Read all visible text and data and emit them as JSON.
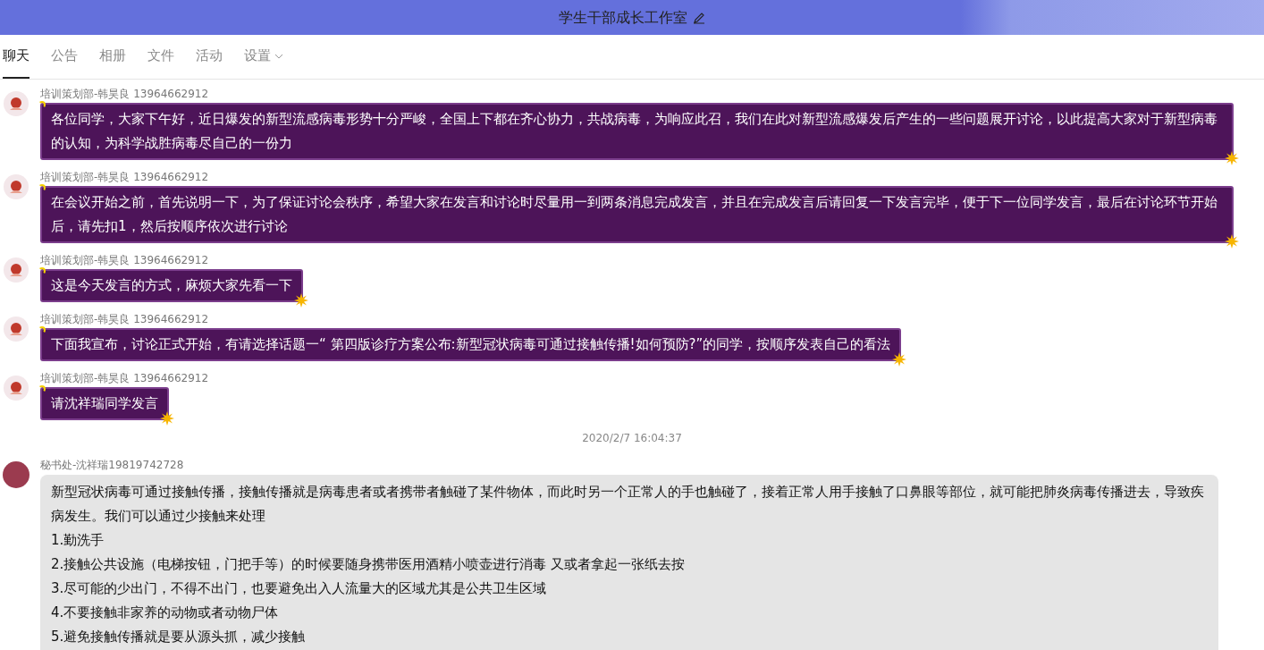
{
  "header": {
    "title": "学生干部成长工作室"
  },
  "tabs": [
    {
      "label": "聊天",
      "selected": true,
      "dropdown": false
    },
    {
      "label": "公告",
      "selected": false,
      "dropdown": false
    },
    {
      "label": "相册",
      "selected": false,
      "dropdown": false
    },
    {
      "label": "文件",
      "selected": false,
      "dropdown": false
    },
    {
      "label": "活动",
      "selected": false,
      "dropdown": false
    },
    {
      "label": "设置",
      "selected": false,
      "dropdown": true
    }
  ],
  "messages": [
    {
      "kind": "decorated",
      "sender": "培训策划部-韩昊良 13964662912",
      "lines": [
        "各位同学，大家下午好，近日爆发的新型流感病毒形势十分严峻，全国上下都在齐心协力，共战病毒，为响应此召，我们在此对新型流感爆发后产生的一些问题展开讨论，以此提高大家对于新型病毒的认知，为科学战胜病毒尽自己的一份力"
      ]
    },
    {
      "kind": "decorated",
      "sender": "培训策划部-韩昊良 13964662912",
      "lines": [
        "在会议开始之前，首先说明一下，为了保证讨论会秩序，希望大家在发言和讨论时尽量用一到两条消息完成发言，并且在完成发言后请回复一下发言完毕，便于下一位同学发言，最后在讨论环节开始后，请先扣1，然后按顺序依次进行讨论"
      ]
    },
    {
      "kind": "decorated",
      "sender": "培训策划部-韩昊良 13964662912",
      "lines": [
        "这是今天发言的方式，麻烦大家先看一下"
      ]
    },
    {
      "kind": "decorated",
      "sender": "培训策划部-韩昊良 13964662912",
      "lines": [
        "下面我宣布，讨论正式开始，有请选择话题一“ 第四版诊疗方案公布:新型冠状病毒可通过接触传播!如何预防?”的同学，按顺序发表自己的看法"
      ]
    },
    {
      "kind": "decorated",
      "sender": "培训策划部-韩昊良 13964662912",
      "lines": [
        "请沈祥瑞同学发言"
      ]
    },
    {
      "kind": "timestamp",
      "text": "2020/2/7 16:04:37"
    },
    {
      "kind": "plain",
      "sender": "秘书处-沈祥瑞19819742728",
      "lines": [
        "新型冠状病毒可通过接触传播，接触传播就是病毒患者或者携带者触碰了某件物体，而此时另一个正常人的手也触碰了，接着正常人用手接触了口鼻眼等部位，就可能把肺炎病毒传播进去，导致疾病发生。我们可以通过少接触来处理",
        "1.勤洗手",
        "2.接触公共设施（电梯按钮，门把手等）的时候要随身携带医用酒精小喷壶进行消毒 又或者拿起一张纸去按",
        "3.尽可能的少出门，不得不出门，也要避免出入人流量大的区域尤其是公共卫生区域",
        "4.不要接触非家养的动物或者动物尸体",
        "5.避免接触传播就是要从源头抓，减少接触"
      ]
    }
  ]
}
